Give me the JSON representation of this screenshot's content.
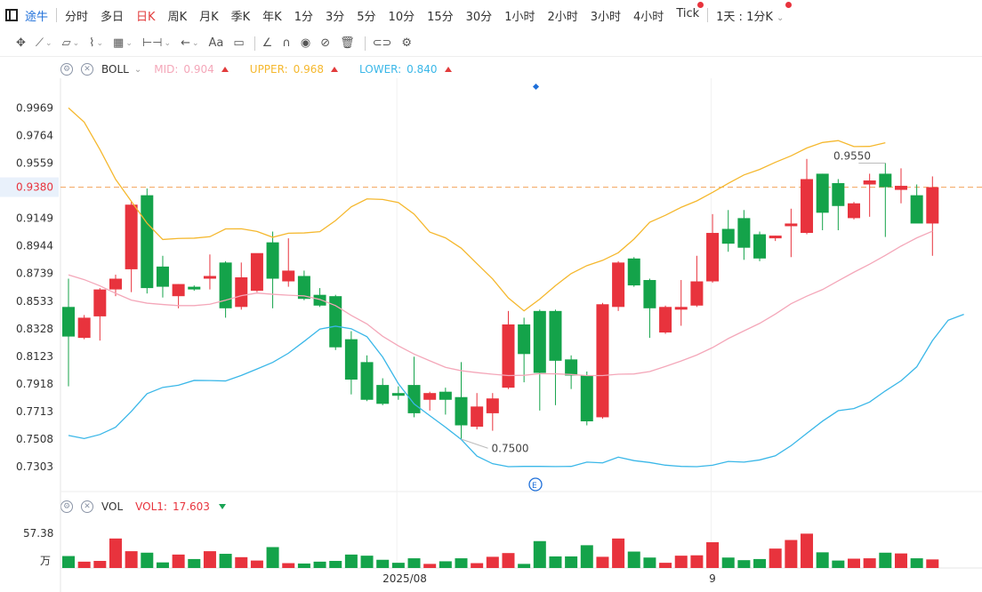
{
  "topbar": {
    "brand": "途牛",
    "periods": [
      "分时",
      "多日",
      "日K",
      "周K",
      "月K",
      "季K",
      "年K",
      "1分",
      "3分",
      "5分",
      "10分",
      "15分",
      "30分",
      "1小时",
      "2小时",
      "3小时",
      "4小时",
      "Tick"
    ],
    "active_period": "日K",
    "dotted": [
      "Tick"
    ],
    "range_selector": "1天 : 1分K",
    "range_dot": true
  },
  "toolbar": {
    "tools": [
      "move-icon",
      "line-icon",
      "channel-icon",
      "wave-icon",
      "fib-icon",
      "measure-icon",
      "arrow-icon",
      "text-icon",
      "note-icon",
      "angle-icon",
      "magnet-icon",
      "eye-icon",
      "hide-icon",
      "trash-icon",
      "link-icon",
      "settings-icon"
    ],
    "text_tool_label": "Aa"
  },
  "indicator_main": {
    "name": "BOLL",
    "mid_label": "MID:",
    "mid_value": "0.904",
    "upper_label": "UPPER:",
    "upper_value": "0.968",
    "lower_label": "LOWER:",
    "lower_value": "0.840",
    "colors": {
      "mid": "#f4a7b9",
      "upper": "#f5b82e",
      "lower": "#3ab7e8"
    }
  },
  "indicator_vol": {
    "name": "VOL",
    "vol1_label": "VOL1:",
    "vol1_value": "17.603",
    "max_label": "57.38",
    "unit_label": "万"
  },
  "chart_data": {
    "type": "candlestick",
    "ylim": [
      0.72,
      1.01
    ],
    "y_ticks": [
      "0.9969",
      "0.9764",
      "0.9559",
      "0.9380",
      "0.9149",
      "0.8944",
      "0.8739",
      "0.8533",
      "0.8328",
      "0.8123",
      "0.7918",
      "0.7713",
      "0.7508",
      "0.7303"
    ],
    "current_price": "0.9380",
    "x_labels": [
      "2025/08",
      "9"
    ],
    "annotations": {
      "low": "0.7500",
      "high": "0.9550"
    },
    "colors": {
      "up": "#e8333d",
      "down": "#14a34a"
    },
    "candles": [
      {
        "o": 0.849,
        "h": 0.87,
        "l": 0.79,
        "c": 0.827
      },
      {
        "o": 0.826,
        "h": 0.843,
        "l": 0.825,
        "c": 0.841
      },
      {
        "o": 0.842,
        "h": 0.863,
        "l": 0.824,
        "c": 0.862
      },
      {
        "o": 0.862,
        "h": 0.873,
        "l": 0.857,
        "c": 0.87
      },
      {
        "o": 0.877,
        "h": 0.927,
        "l": 0.86,
        "c": 0.925
      },
      {
        "o": 0.932,
        "h": 0.937,
        "l": 0.859,
        "c": 0.863
      },
      {
        "o": 0.879,
        "h": 0.887,
        "l": 0.856,
        "c": 0.864
      },
      {
        "o": 0.857,
        "h": 0.866,
        "l": 0.848,
        "c": 0.866
      },
      {
        "o": 0.864,
        "h": 0.865,
        "l": 0.861,
        "c": 0.862
      },
      {
        "o": 0.87,
        "h": 0.888,
        "l": 0.862,
        "c": 0.872
      },
      {
        "o": 0.882,
        "h": 0.883,
        "l": 0.841,
        "c": 0.848
      },
      {
        "o": 0.849,
        "h": 0.882,
        "l": 0.847,
        "c": 0.871
      },
      {
        "o": 0.861,
        "h": 0.888,
        "l": 0.86,
        "c": 0.889
      },
      {
        "o": 0.897,
        "h": 0.905,
        "l": 0.848,
        "c": 0.87
      },
      {
        "o": 0.868,
        "h": 0.9,
        "l": 0.864,
        "c": 0.876
      },
      {
        "o": 0.872,
        "h": 0.876,
        "l": 0.854,
        "c": 0.855
      },
      {
        "o": 0.858,
        "h": 0.863,
        "l": 0.849,
        "c": 0.85
      },
      {
        "o": 0.857,
        "h": 0.858,
        "l": 0.817,
        "c": 0.819
      },
      {
        "o": 0.825,
        "h": 0.831,
        "l": 0.784,
        "c": 0.795
      },
      {
        "o": 0.808,
        "h": 0.813,
        "l": 0.779,
        "c": 0.78
      },
      {
        "o": 0.791,
        "h": 0.796,
        "l": 0.776,
        "c": 0.777
      },
      {
        "o": 0.785,
        "h": 0.79,
        "l": 0.78,
        "c": 0.783
      },
      {
        "o": 0.791,
        "h": 0.812,
        "l": 0.767,
        "c": 0.77
      },
      {
        "o": 0.78,
        "h": 0.786,
        "l": 0.772,
        "c": 0.785
      },
      {
        "o": 0.786,
        "h": 0.789,
        "l": 0.769,
        "c": 0.78
      },
      {
        "o": 0.782,
        "h": 0.808,
        "l": 0.751,
        "c": 0.761
      },
      {
        "o": 0.76,
        "h": 0.785,
        "l": 0.758,
        "c": 0.775
      },
      {
        "o": 0.77,
        "h": 0.785,
        "l": 0.757,
        "c": 0.781
      },
      {
        "o": 0.789,
        "h": 0.846,
        "l": 0.788,
        "c": 0.836
      },
      {
        "o": 0.836,
        "h": 0.841,
        "l": 0.793,
        "c": 0.814
      },
      {
        "o": 0.846,
        "h": 0.847,
        "l": 0.772,
        "c": 0.8
      },
      {
        "o": 0.846,
        "h": 0.847,
        "l": 0.776,
        "c": 0.809
      },
      {
        "o": 0.81,
        "h": 0.813,
        "l": 0.788,
        "c": 0.798
      },
      {
        "o": 0.798,
        "h": 0.801,
        "l": 0.761,
        "c": 0.764
      },
      {
        "o": 0.767,
        "h": 0.852,
        "l": 0.766,
        "c": 0.851
      },
      {
        "o": 0.849,
        "h": 0.883,
        "l": 0.846,
        "c": 0.882
      },
      {
        "o": 0.885,
        "h": 0.886,
        "l": 0.864,
        "c": 0.865
      },
      {
        "o": 0.869,
        "h": 0.87,
        "l": 0.826,
        "c": 0.848
      },
      {
        "o": 0.83,
        "h": 0.85,
        "l": 0.829,
        "c": 0.849
      },
      {
        "o": 0.847,
        "h": 0.869,
        "l": 0.835,
        "c": 0.849
      },
      {
        "o": 0.85,
        "h": 0.887,
        "l": 0.849,
        "c": 0.868
      },
      {
        "o": 0.868,
        "h": 0.918,
        "l": 0.867,
        "c": 0.904
      },
      {
        "o": 0.907,
        "h": 0.921,
        "l": 0.89,
        "c": 0.896
      },
      {
        "o": 0.915,
        "h": 0.921,
        "l": 0.884,
        "c": 0.893
      },
      {
        "o": 0.903,
        "h": 0.905,
        "l": 0.883,
        "c": 0.885
      },
      {
        "o": 0.9,
        "h": 0.902,
        "l": 0.898,
        "c": 0.902
      },
      {
        "o": 0.909,
        "h": 0.922,
        "l": 0.886,
        "c": 0.911
      },
      {
        "o": 0.904,
        "h": 0.959,
        "l": 0.903,
        "c": 0.944
      },
      {
        "o": 0.948,
        "h": 0.948,
        "l": 0.906,
        "c": 0.919
      },
      {
        "o": 0.941,
        "h": 0.944,
        "l": 0.906,
        "c": 0.924
      },
      {
        "o": 0.915,
        "h": 0.927,
        "l": 0.914,
        "c": 0.926
      },
      {
        "o": 0.94,
        "h": 0.948,
        "l": 0.916,
        "c": 0.943
      },
      {
        "o": 0.948,
        "h": 0.956,
        "l": 0.901,
        "c": 0.938
      },
      {
        "o": 0.936,
        "h": 0.952,
        "l": 0.926,
        "c": 0.939
      },
      {
        "o": 0.932,
        "h": 0.94,
        "l": 0.913,
        "c": 0.911
      },
      {
        "o": 0.911,
        "h": 0.946,
        "l": 0.887,
        "c": 0.938
      }
    ],
    "volume": [
      0.32,
      0.17,
      0.19,
      0.79,
      0.45,
      0.41,
      0.15,
      0.36,
      0.24,
      0.45,
      0.38,
      0.29,
      0.2,
      0.56,
      0.13,
      0.12,
      0.17,
      0.19,
      0.36,
      0.33,
      0.22,
      0.14,
      0.26,
      0.11,
      0.18,
      0.26,
      0.13,
      0.3,
      0.4,
      0.11,
      0.72,
      0.31,
      0.31,
      0.61,
      0.3,
      0.79,
      0.44,
      0.28,
      0.14,
      0.33,
      0.34,
      0.69,
      0.28,
      0.21,
      0.24,
      0.52,
      0.75,
      0.92,
      0.42,
      0.2,
      0.25,
      0.26,
      0.41,
      0.39,
      0.26,
      0.23
    ],
    "upper": [
      0.9969,
      0.9863,
      0.966,
      0.9438,
      0.9275,
      0.9112,
      0.8991,
      0.8999,
      0.9001,
      0.9012,
      0.907,
      0.9071,
      0.9051,
      0.9008,
      0.9038,
      0.904,
      0.9049,
      0.9132,
      0.9234,
      0.9293,
      0.9289,
      0.9266,
      0.918,
      0.9046,
      0.9003,
      0.8927,
      0.8812,
      0.8698,
      0.8557,
      0.8461,
      0.8548,
      0.8648,
      0.8738,
      0.8797,
      0.8836,
      0.8893,
      0.8994,
      0.9119,
      0.9171,
      0.923,
      0.9278,
      0.9341,
      0.9408,
      0.9471,
      0.9512,
      0.9565,
      0.9613,
      0.9671,
      0.9712,
      0.9726,
      0.9682,
      0.9683,
      0.971
    ],
    "mid": [
      0.8728,
      0.8693,
      0.8647,
      0.8591,
      0.8541,
      0.8518,
      0.8508,
      0.85,
      0.85,
      0.851,
      0.854,
      0.8574,
      0.8593,
      0.8584,
      0.8577,
      0.8572,
      0.8546,
      0.85,
      0.8427,
      0.8364,
      0.8272,
      0.8201,
      0.814,
      0.809,
      0.8041,
      0.8016,
      0.8002,
      0.799,
      0.798,
      0.7982,
      0.7994,
      0.7993,
      0.7988,
      0.798,
      0.798,
      0.799,
      0.7992,
      0.801,
      0.8048,
      0.8088,
      0.8133,
      0.8188,
      0.8255,
      0.8312,
      0.8368,
      0.8437,
      0.8514,
      0.857,
      0.8619,
      0.8684,
      0.8748,
      0.8808,
      0.8873,
      0.8942,
      0.9003,
      0.9053
    ],
    "lower": [
      0.7535,
      0.7512,
      0.7542,
      0.7596,
      0.7714,
      0.7845,
      0.7892,
      0.7908,
      0.7944,
      0.7943,
      0.794,
      0.7981,
      0.8029,
      0.8078,
      0.8146,
      0.8234,
      0.8325,
      0.8347,
      0.8328,
      0.8269,
      0.8118,
      0.792,
      0.7769,
      0.7682,
      0.7596,
      0.7505,
      0.7382,
      0.7325,
      0.7303,
      0.7305,
      0.7305,
      0.7304,
      0.7305,
      0.7337,
      0.7331,
      0.7374,
      0.7348,
      0.7334,
      0.7314,
      0.7305,
      0.7303,
      0.7314,
      0.7342,
      0.7337,
      0.7353,
      0.7384,
      0.7459,
      0.7551,
      0.7641,
      0.7719,
      0.7735,
      0.7783,
      0.7866,
      0.7941,
      0.8045,
      0.824,
      0.8391,
      0.8435
    ]
  }
}
